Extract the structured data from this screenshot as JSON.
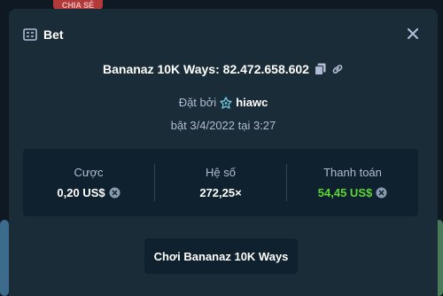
{
  "background": {
    "badge_text": "CHIA SẺ"
  },
  "modal": {
    "title": "Bet",
    "header_icon": "ticket-icon",
    "close_icon": "close-icon"
  },
  "game": {
    "name": "Bananaz 10K Ways",
    "separator": ": ",
    "bet_id": "82.472.658.602",
    "copy_icon": "copy-icon",
    "link_icon": "link-icon"
  },
  "placed_by": {
    "prefix": "Đặt bởi",
    "username": "hiawc",
    "vip_icon": "crown-icon"
  },
  "timestamp": "bật 3/4/2022 tại 3:27",
  "stats": {
    "bet_label": "Cược",
    "bet_value": "0,20 US$",
    "multiplier_label": "Hệ số",
    "multiplier_value": "272,25×",
    "payout_label": "Thanh toán",
    "payout_value": "54,45 US$",
    "currency_icon": "currency-icon"
  },
  "play_button": "Chơi Bananaz 10K Ways",
  "colors": {
    "modal_bg": "#1a2c38",
    "panel_bg": "#0f212e",
    "muted_text": "#b1bad3",
    "win_green": "#5dd634"
  }
}
